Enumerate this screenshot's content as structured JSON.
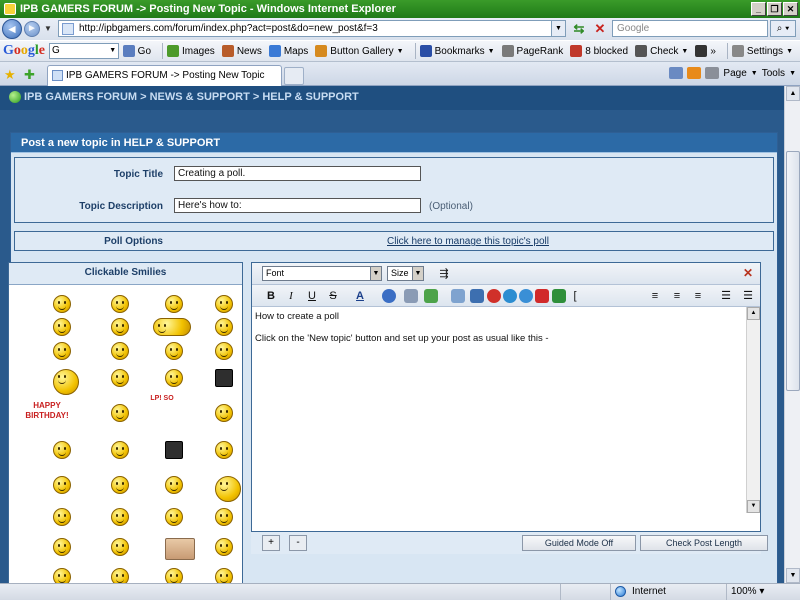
{
  "window": {
    "title": "IPB GAMERS FORUM -> Posting New Topic - Windows Internet Explorer",
    "buttons": [
      "_",
      "❐",
      "✕"
    ]
  },
  "address_bar": {
    "url": "http://ipbgamers.com/forum/index.php?act=post&do=new_post&f=3",
    "search_placeholder": "Google"
  },
  "google_toolbar": {
    "logo": [
      "G",
      "o",
      "o",
      "g",
      "l",
      "e"
    ],
    "input_value": "G",
    "items": [
      {
        "label": "Go",
        "icon": "go-arrow-icon",
        "color": "#5a7dbf"
      },
      {
        "label": "Images",
        "icon": "images-icon",
        "color": "#4c9a2a"
      },
      {
        "label": "News",
        "icon": "news-icon",
        "color": "#b85c2a"
      },
      {
        "label": "Maps",
        "icon": "maps-icon",
        "color": "#3a7ad6"
      },
      {
        "label": "Button Gallery",
        "icon": "button-gallery-icon",
        "color": "#d68a1e"
      },
      {
        "label": "Bookmarks",
        "icon": "bookmarks-star-icon",
        "color": "#2a4ea6"
      },
      {
        "label": "PageRank",
        "icon": "pagerank-icon",
        "color": "#7a7a7a"
      },
      {
        "label": "8 blocked",
        "icon": "popup-blocked-icon",
        "color": "#c0392b"
      },
      {
        "label": "Check",
        "icon": "spellcheck-icon",
        "color": "#555555"
      },
      {
        "label": "»",
        "icon": "more-icon",
        "color": "#333333"
      },
      {
        "label": "Settings",
        "icon": "settings-icon",
        "color": "#888888"
      }
    ]
  },
  "tabs": {
    "active_label": "IPB GAMERS FORUM -> Posting New Topic",
    "commands": [
      "Page",
      "Tools"
    ]
  },
  "forum": {
    "breadcrumb": "IPB GAMERS FORUM > NEWS & SUPPORT > HELP & SUPPORT",
    "panel_title": "Post a new topic in HELP & SUPPORT",
    "topic_title_label": "Topic Title",
    "topic_title_value": "Creating a poll.",
    "topic_desc_label": "Topic Description",
    "topic_desc_value": "Here's how to:",
    "optional_label": "(Optional)",
    "poll_label": "Poll Options",
    "poll_link": "Click here to manage this topic's poll",
    "smilies_title": "Clickable Smilies",
    "smilies_bday_text": "HAPPY BIRTHDAY!",
    "smilies_lp_text": "LP! SO"
  },
  "editor": {
    "font_select": "Font",
    "size_select": "Size",
    "format_buttons": [
      "B",
      "I",
      "U",
      "S"
    ],
    "lines": [
      "How to create a poll",
      "Click on the 'New topic' button and set up your post as usual like this -"
    ],
    "add_button": "+",
    "remove_button": "-",
    "guided_mode": "Guided Mode Off",
    "check_length": "Check Post Length"
  },
  "status_bar": {
    "zone": "Internet",
    "zoom": "100%"
  }
}
